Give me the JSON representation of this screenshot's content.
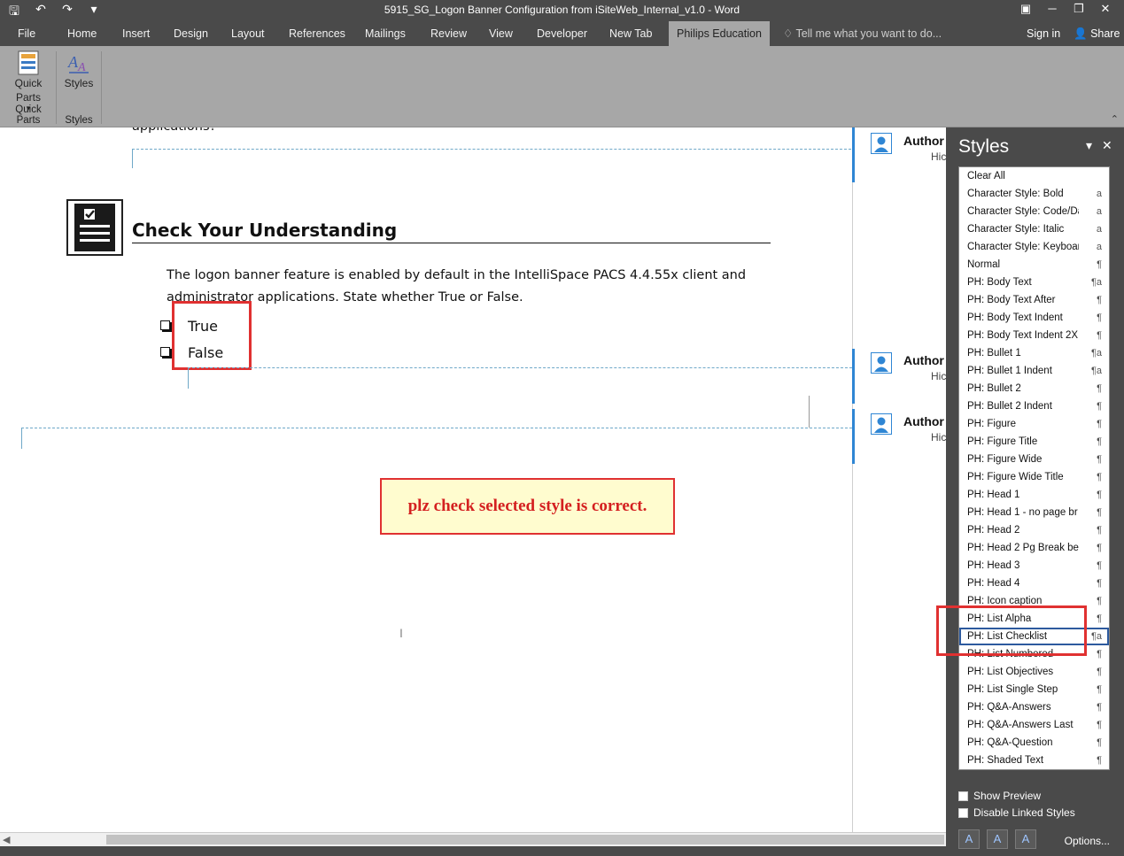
{
  "window": {
    "title": "5915_SG_Logon Banner Configuration from iSiteWeb_Internal_v1.0 - Word"
  },
  "ribbon_tabs": [
    {
      "label": "File"
    },
    {
      "label": "Home"
    },
    {
      "label": "Insert"
    },
    {
      "label": "Design"
    },
    {
      "label": "Layout"
    },
    {
      "label": "References"
    },
    {
      "label": "Mailings"
    },
    {
      "label": "Review"
    },
    {
      "label": "View"
    },
    {
      "label": "Developer"
    },
    {
      "label": "New Tab"
    },
    {
      "label": "Philips Education",
      "active": true
    }
  ],
  "tell_me": "Tell me what you want to do...",
  "sign_in": "Sign in",
  "share": "Share",
  "ribbon": {
    "quick_parts_button": "Quick Parts",
    "quick_parts_group": "Quick Parts",
    "styles_button": "Styles",
    "styles_group": "Styles"
  },
  "document": {
    "partial_line": "applications?",
    "heading": "Check Your Understanding",
    "question_line1": "The logon banner feature is enabled by default in the IntelliSpace PACS 4.4.55x client and",
    "question_line2": "administrator applications. State whether True or False.",
    "option_true": "True",
    "option_false": "False",
    "callout": "plz check selected style is correct."
  },
  "comments": [
    {
      "author": "Author",
      "initials": "Hic"
    },
    {
      "author": "Author",
      "initials": "Hic"
    },
    {
      "author": "Author",
      "initials": "Hic"
    }
  ],
  "styles_pane": {
    "title": "Styles",
    "items": [
      {
        "name": "Clear All",
        "icon": ""
      },
      {
        "name": "Character Style: Bold",
        "icon": "a"
      },
      {
        "name": "Character Style: Code/Da",
        "icon": "a"
      },
      {
        "name": "Character Style: Italic",
        "icon": "a"
      },
      {
        "name": "Character Style: Keyboar",
        "icon": "a"
      },
      {
        "name": "Normal",
        "icon": "¶"
      },
      {
        "name": "PH: Body Text",
        "icon": "¶a"
      },
      {
        "name": "PH: Body Text After",
        "icon": "¶"
      },
      {
        "name": "PH: Body Text Indent",
        "icon": "¶"
      },
      {
        "name": "PH: Body Text Indent 2X",
        "icon": "¶"
      },
      {
        "name": "PH: Bullet 1",
        "icon": "¶a"
      },
      {
        "name": "PH: Bullet 1 Indent",
        "icon": "¶a"
      },
      {
        "name": "PH: Bullet 2",
        "icon": "¶"
      },
      {
        "name": "PH: Bullet 2 Indent",
        "icon": "¶"
      },
      {
        "name": "PH: Figure",
        "icon": "¶"
      },
      {
        "name": "PH: Figure Title",
        "icon": "¶"
      },
      {
        "name": "PH: Figure Wide",
        "icon": "¶"
      },
      {
        "name": "PH: Figure Wide Title",
        "icon": "¶"
      },
      {
        "name": "PH: Head 1",
        "icon": "¶"
      },
      {
        "name": "PH: Head 1 - no page br",
        "icon": "¶"
      },
      {
        "name": "PH: Head 2",
        "icon": "¶"
      },
      {
        "name": "PH: Head 2 Pg Break bef",
        "icon": "¶"
      },
      {
        "name": "PH: Head 3",
        "icon": "¶"
      },
      {
        "name": "PH: Head 4",
        "icon": "¶"
      },
      {
        "name": "PH: Icon caption",
        "icon": "¶"
      },
      {
        "name": "PH: List Alpha",
        "icon": "¶"
      },
      {
        "name": "PH: List Checklist",
        "icon": "¶a",
        "selected": true
      },
      {
        "name": "PH: List Numbered",
        "icon": "¶"
      },
      {
        "name": "PH: List Objectives",
        "icon": "¶"
      },
      {
        "name": "PH: List Single Step",
        "icon": "¶"
      },
      {
        "name": "PH: Q&A-Answers",
        "icon": "¶"
      },
      {
        "name": "PH: Q&A-Answers Last",
        "icon": "¶"
      },
      {
        "name": "PH: Q&A-Question",
        "icon": "¶"
      },
      {
        "name": "PH: Shaded Text",
        "icon": "¶"
      }
    ],
    "show_preview": "Show Preview",
    "disable_linked": "Disable Linked Styles",
    "options": "Options..."
  }
}
